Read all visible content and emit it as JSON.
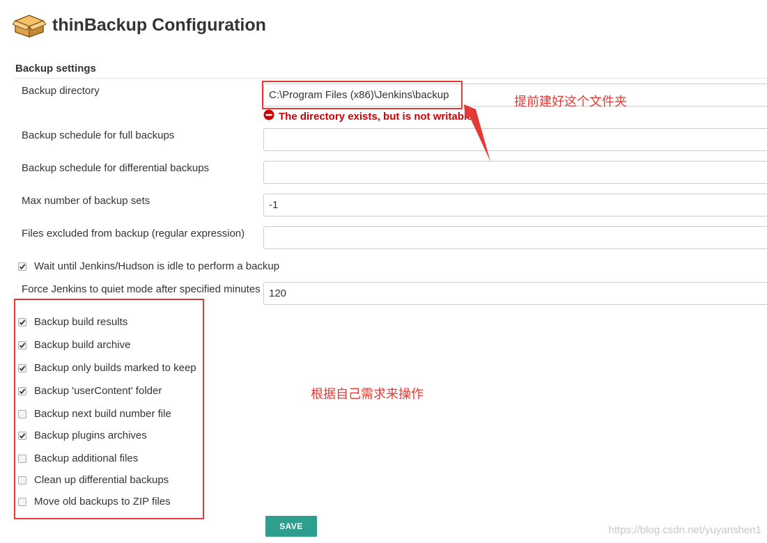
{
  "header": {
    "title": "thinBackup Configuration",
    "icon": "package-box-icon"
  },
  "section": {
    "title": "Backup settings"
  },
  "fields": {
    "backup_directory": {
      "label": "Backup directory",
      "value": "C:\\Program Files (x86)\\Jenkins\\backup"
    },
    "full_schedule": {
      "label": "Backup schedule for full backups",
      "value": ""
    },
    "diff_schedule": {
      "label": "Backup schedule for differential backups",
      "value": ""
    },
    "max_sets": {
      "label": "Max number of backup sets",
      "value": "-1"
    },
    "excluded": {
      "label": "Files excluded from backup (regular expression)",
      "value": ""
    },
    "quiet_minutes": {
      "label": "Force Jenkins to quiet mode after specified minutes",
      "value": "120"
    }
  },
  "error": {
    "text": "The directory exists, but is not writable",
    "icon": "error-circle-icon"
  },
  "wait_idle": {
    "label": "Wait until Jenkins/Hudson is idle to perform a backup",
    "checked": true
  },
  "options": [
    {
      "label": "Backup build results",
      "checked": true
    },
    {
      "label": "Backup build archive",
      "checked": true
    },
    {
      "label": "Backup only builds marked to keep",
      "checked": true
    },
    {
      "label": "Backup 'userContent' folder",
      "checked": true
    },
    {
      "label": "Backup next build number file",
      "checked": false
    },
    {
      "label": "Backup plugins archives",
      "checked": true
    },
    {
      "label": "Backup additional files",
      "checked": false
    },
    {
      "label": "Clean up differential backups",
      "checked": false
    },
    {
      "label": "Move old backups to ZIP files",
      "checked": false
    }
  ],
  "annotations": {
    "note1": "提前建好这个文件夹",
    "note2": "根据自己需求来操作"
  },
  "save": {
    "label": "SAVE"
  },
  "watermark": "https://blog.csdn.net/yuyanshen1",
  "colors": {
    "annotation_red": "#e53935",
    "error_red": "#cc0000",
    "save_teal": "#2e9e8f"
  }
}
